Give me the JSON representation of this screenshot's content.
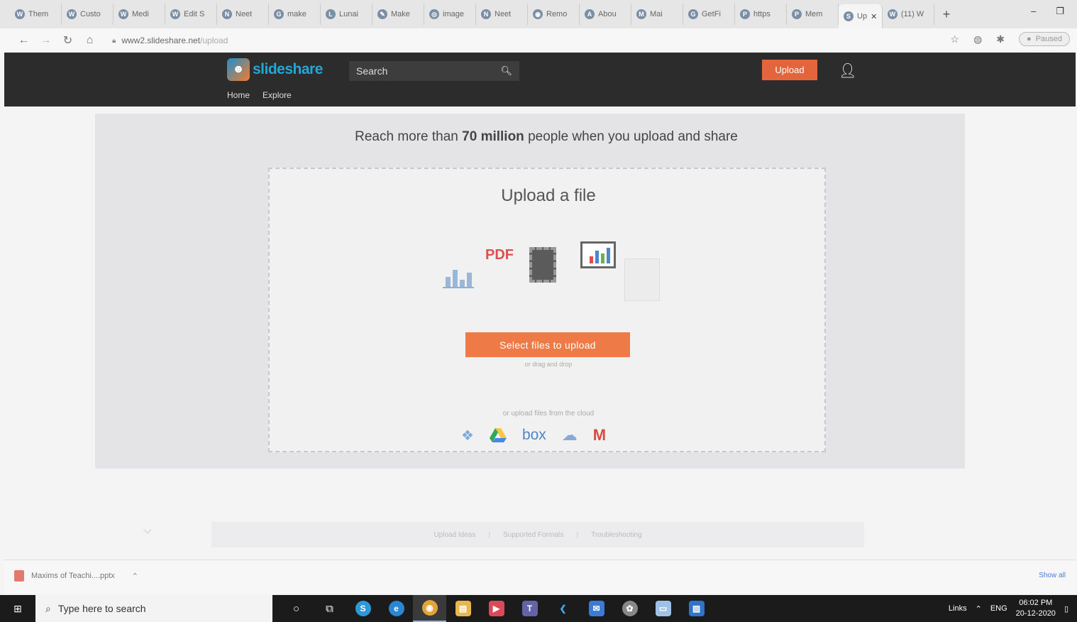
{
  "browser": {
    "tabs": [
      {
        "label": "Them",
        "icon": "wordpress-icon",
        "glyph": "W"
      },
      {
        "label": "Custo",
        "icon": "wordpress-icon",
        "glyph": "W"
      },
      {
        "label": "Medi",
        "icon": "wordpress-icon",
        "glyph": "W"
      },
      {
        "label": "Edit S",
        "icon": "wordpress-icon",
        "glyph": "W"
      },
      {
        "label": "Neet",
        "icon": "note-icon",
        "glyph": "N"
      },
      {
        "label": "make",
        "icon": "google-icon",
        "glyph": "G"
      },
      {
        "label": "Lunai",
        "icon": "image-icon",
        "glyph": "L"
      },
      {
        "label": "Make",
        "icon": "tool-icon",
        "glyph": "✎"
      },
      {
        "label": "image",
        "icon": "globe-icon",
        "glyph": "◎"
      },
      {
        "label": "Neet",
        "icon": "note-icon",
        "glyph": "N"
      },
      {
        "label": "Remo",
        "icon": "eye-icon",
        "glyph": "◉"
      },
      {
        "label": "Abou",
        "icon": "page-icon",
        "glyph": "A"
      },
      {
        "label": "Mai",
        "icon": "mail-icon",
        "glyph": "M"
      },
      {
        "label": "GetFi",
        "icon": "mail-icon",
        "glyph": "G"
      },
      {
        "label": "https",
        "icon": "pinterest-icon",
        "glyph": "P"
      },
      {
        "label": "Mem",
        "icon": "pinterest-icon",
        "glyph": "P"
      },
      {
        "label": "Up",
        "icon": "slideshare-icon",
        "glyph": "S",
        "active": true
      },
      {
        "label": "(11) W",
        "icon": "whatsapp-icon",
        "glyph": "W"
      }
    ],
    "new_tab": "+",
    "window_controls": {
      "minimize": "–",
      "restore": "❐"
    },
    "url_domain": "www2.slideshare.net",
    "url_path": "/upload",
    "profile_status": "Paused"
  },
  "site": {
    "logo_text": "slideshare",
    "search_placeholder": "Search",
    "upload_label": "Upload",
    "nav": [
      "Home",
      "Explore"
    ]
  },
  "main": {
    "tagline_pre": "Reach more than ",
    "tagline_bold": "70 million",
    "tagline_post": " people when you upload and share",
    "upload_title": "Upload a file",
    "pdf_label": "PDF",
    "select_button": "Select files to upload",
    "drag_hint": "or drag and drop",
    "cloud_hint": "or upload files from the cloud",
    "cloud_box": "box",
    "footer_links": [
      "Upload Ideas",
      "Supported Formats",
      "Troubleshooting"
    ]
  },
  "download": {
    "file_name": "Maxims of Teachi....pptx",
    "show_all": "Show all"
  },
  "taskbar": {
    "search_placeholder": "Type here to search",
    "tray_links": "Links",
    "lang": "ENG",
    "time": "06:02 PM",
    "date": "20-12-2020"
  }
}
